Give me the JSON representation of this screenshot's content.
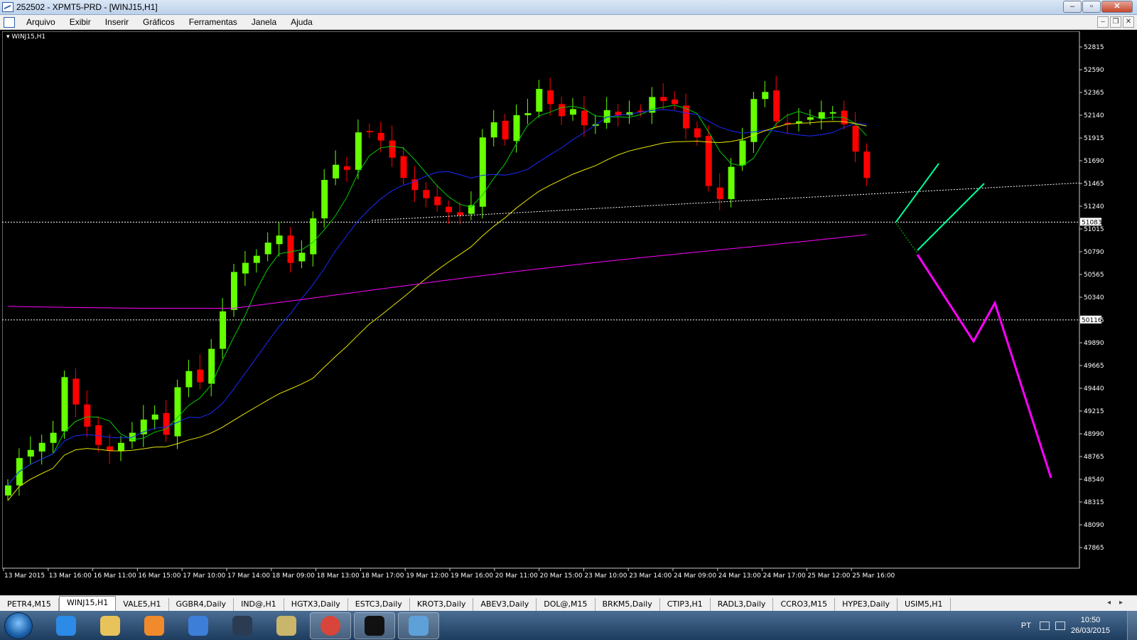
{
  "window": {
    "title": "252502 - XPMT5-PRD - [WINJ15,H1]",
    "btn_min": "‒",
    "btn_max": "▫",
    "btn_close": "✕"
  },
  "menu": {
    "items": [
      "Arquivo",
      "Exibir",
      "Inserir",
      "Gráficos",
      "Ferramentas",
      "Janela",
      "Ajuda"
    ]
  },
  "mdi": {
    "min": "–",
    "restore": "❐",
    "close": "✕"
  },
  "chart": {
    "symbol_label": "WINJ15,H1",
    "background": "#000000",
    "bull_color": "#66ff00",
    "bear_color": "#ff0000",
    "price_axis": [
      "52815",
      "52590",
      "52365",
      "52140",
      "51915",
      "51690",
      "51465",
      "51240",
      "51015",
      "50790",
      "50565",
      "50340",
      "50115",
      "49890",
      "49665",
      "49440",
      "49215",
      "48990",
      "48765",
      "48540",
      "48315",
      "48090",
      "47865"
    ],
    "price_tags": [
      "51083",
      "50116"
    ],
    "time_axis": [
      "13 Mar 2015",
      "13 Mar 16:00",
      "16 Mar 11:00",
      "16 Mar 15:00",
      "17 Mar 10:00",
      "17 Mar 14:00",
      "18 Mar 09:00",
      "18 Mar 13:00",
      "18 Mar 17:00",
      "19 Mar 12:00",
      "19 Mar 16:00",
      "20 Mar 11:00",
      "20 Mar 15:00",
      "23 Mar 10:00",
      "23 Mar 14:00",
      "24 Mar 09:00",
      "24 Mar 13:00",
      "24 Mar 17:00",
      "25 Mar 12:00",
      "25 Mar 16:00"
    ],
    "ma_colors": {
      "fast": "#00cc00",
      "mid": "#1a2aff",
      "slow": "#e6e600",
      "long": "#ff00ff"
    }
  },
  "tabs": {
    "items": [
      "PETR4,M15",
      "WINJ15,H1",
      "VALE5,H1",
      "GGBR4,Daily",
      "IND@,H1",
      "HGTX3,Daily",
      "ESTC3,Daily",
      "KROT3,Daily",
      "ABEV3,Daily",
      "DOL@,M15",
      "BRKM5,Daily",
      "CTIP3,H1",
      "RADL3,Daily",
      "CCRO3,M15",
      "HYPE3,Daily",
      "USIM5,H1"
    ],
    "active": "WINJ15,H1",
    "nav": "◂▸"
  },
  "taskbar": {
    "apps": [
      "ie-icon",
      "explorer-icon",
      "media-icon",
      "network-icon",
      "hp-icon",
      "tool-icon",
      "chrome-icon",
      "xp-icon",
      "metatrader-icon"
    ],
    "lang": "PT",
    "time": "10:50",
    "date": "26/03/2015"
  }
}
